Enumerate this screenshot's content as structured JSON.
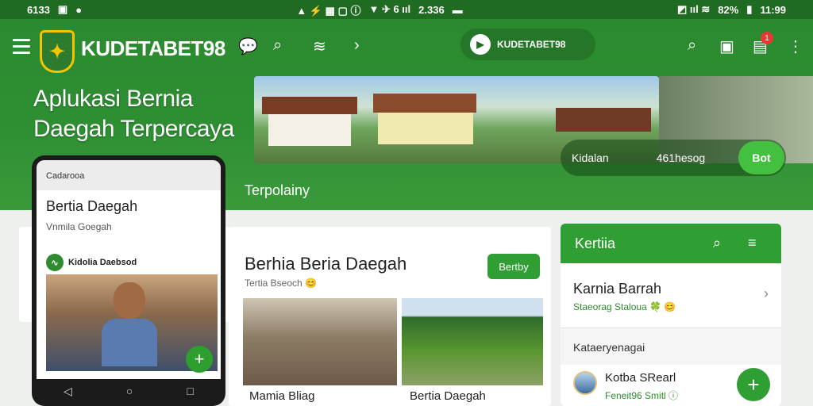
{
  "status_bar": {
    "time_left": "6133",
    "middle": "2.336",
    "battery": "82%",
    "time_right": "11:99"
  },
  "header": {
    "brand": "KUDETABET98",
    "play_label": "KUDETABET98",
    "notification_count": "1",
    "hero_title_line1": "Aplukasi Bernia",
    "hero_title_line2": "Daegah Terpercaya",
    "subtitle": "Terpolainy",
    "pill": {
      "left": "Kidalan",
      "middle": "461hesog",
      "button": "Bot"
    }
  },
  "phone": {
    "topbar": "Cadarooa",
    "title": "Bertia Daegah",
    "subtitle": "Vnmila Goegah",
    "row_label": "Kidolia Daebsod"
  },
  "main_card": {
    "title": "Berhia Beria Daegah",
    "meta": "Tertia Bseoch 😊",
    "button": "Bertby",
    "caption1": "Mamia Bliag",
    "caption2": "Bertia Daegah"
  },
  "side_panel": {
    "header": "Kertiia",
    "item1_name": "Karnia Barrah",
    "item1_sub": "Staeorag Staloua 🍀 😊",
    "section_label": "Kataeryenagai",
    "item2_name": "Kotba SRearl",
    "item2_sub": "Feneit96 Smitl ⓘ"
  },
  "colors": {
    "primary": "#2f9e33",
    "dark": "#1f6b22",
    "accent": "#43c03f"
  }
}
